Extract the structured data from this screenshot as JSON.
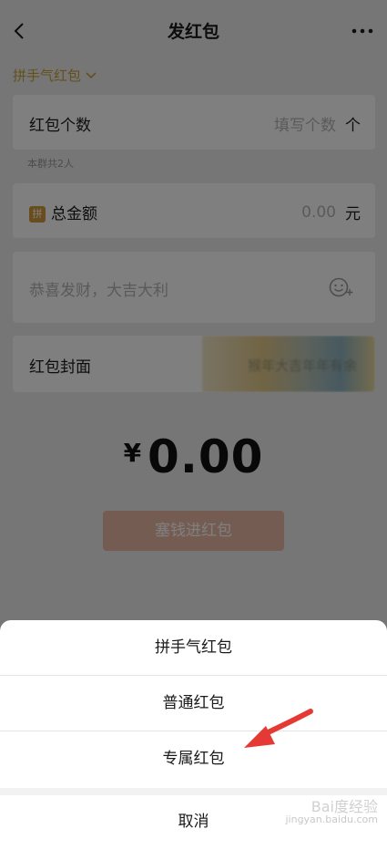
{
  "nav": {
    "title": "发红包"
  },
  "type_switch": {
    "label": "拼手气红包"
  },
  "count_row": {
    "label": "红包个数",
    "placeholder": "填写个数",
    "unit": "个"
  },
  "group_hint": "本群共2人",
  "amount_row": {
    "badge": "拼",
    "label": "总金额",
    "value": "0.00",
    "unit": "元"
  },
  "message_row": {
    "placeholder": "恭喜发财，大吉大利"
  },
  "cover_row": {
    "label": "红包封面",
    "preview_text": "猴年大吉年年有余"
  },
  "total": {
    "currency": "¥",
    "amount": "0.00"
  },
  "submit": {
    "label": "塞钱进红包"
  },
  "action_sheet": {
    "options": [
      "拼手气红包",
      "普通红包",
      "专属红包"
    ],
    "cancel": "取消"
  },
  "watermark": {
    "brand": "Bai度经验",
    "url": "jingyan.baidu.com"
  },
  "colors": {
    "accent": "#c9a13a",
    "red_packet": "#d9534f",
    "arrow": "#e53935"
  }
}
